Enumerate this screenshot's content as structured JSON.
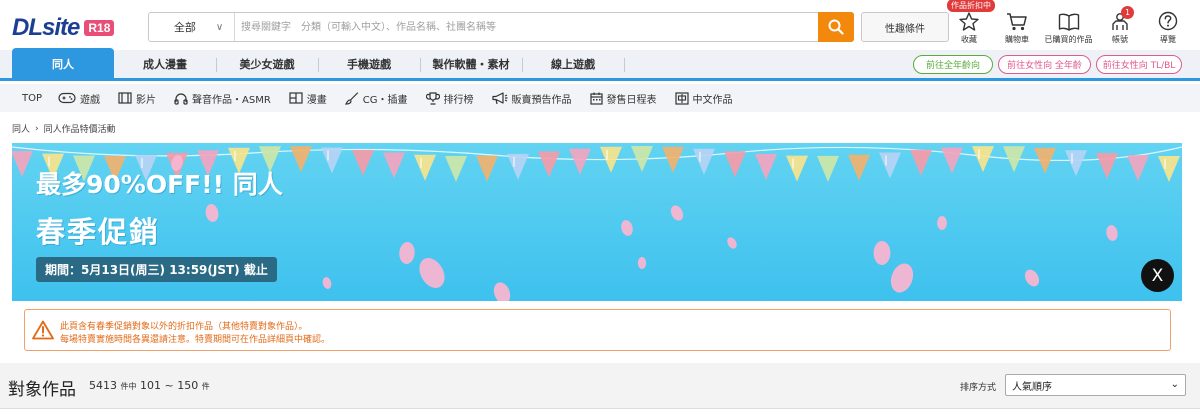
{
  "header": {
    "logo": "DLsite",
    "logo_badge": "R18",
    "search_category": "全部",
    "search_placeholder": "搜尋關鍵字　分類（可輸入中文）、作品名稱、社團名稱等",
    "pref_button": "性趣條件",
    "sale_tag": "作品折扣中",
    "icons": {
      "favorites": "收藏",
      "cart": "購物車",
      "purchased": "已購買的作品",
      "account": "帳號",
      "guide": "導覽"
    },
    "notification_count": "1"
  },
  "floor_tabs": [
    {
      "label": "同人",
      "active": true
    },
    {
      "label": "成人漫畫"
    },
    {
      "label": "美少女遊戲"
    },
    {
      "label": "手機遊戲"
    },
    {
      "label": "製作軟體・素材"
    },
    {
      "label": "線上遊戲"
    }
  ],
  "floor_links": {
    "all_ages": "前往全年齡向",
    "female_all_ages": "前往女性向 全年齡",
    "female_tl_bl": "前往女性向 TL/BL"
  },
  "category_nav": {
    "top": "TOP",
    "items": [
      "遊戲",
      "影片",
      "聲音作品・ASMR",
      "漫畫",
      "CG・插畫",
      "排行榜",
      "販賣預告作品",
      "發售日程表",
      "中文作品"
    ]
  },
  "breadcrumb": {
    "root": "同人",
    "current": "同人作品特價活動"
  },
  "banner": {
    "title_line1": "最多90%OFF!! 同人",
    "title_line2": "春季促銷",
    "period": "期間：5月13日(周三) 13:59(JST) 截止",
    "share_icon": "X"
  },
  "notice": {
    "line1": "此頁含有春季促銷對象以外的折扣作品（其他特賣對象作品）。",
    "line2": "每場特賣實施時間各異還請注意。特賣期間可在作品詳細頁中確認。"
  },
  "results": {
    "title": "對象作品",
    "total": "5413",
    "of_label": "件中",
    "range": "101 ~ 150",
    "unit": "件",
    "sort_label": "排序方式",
    "sort_value": "人氣順序"
  },
  "colors": {
    "brand_blue": "#1c3f94",
    "r18_pink": "#e94e77",
    "search_orange": "#f2880c",
    "tab_blue": "#2d97df",
    "all_ages_green": "#5aaa3c",
    "female_pink": "#e05a8c",
    "notice_orange": "#e26a17",
    "banner_sky": "#3ec1ee"
  }
}
